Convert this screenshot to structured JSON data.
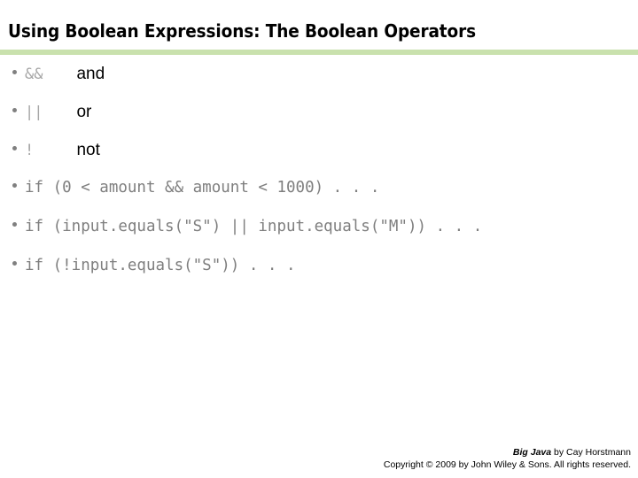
{
  "slide": {
    "title": "Using Boolean Expressions: The Boolean Operators",
    "accent_color": "#c9e1ad",
    "code_color": "#7f7f7f",
    "operator_symbol_color": "#a6a6a6",
    "bullet_color": "#808080"
  },
  "operators": [
    {
      "symbol": "&&",
      "word": "and"
    },
    {
      "symbol": "||",
      "word": "or"
    },
    {
      "symbol": "!",
      "word": "not"
    }
  ],
  "examples": [
    {
      "code": "if (0 < amount && amount < 1000) . . ."
    },
    {
      "code": "if (input.equals(\"S\") || input.equals(\"M\")) . . ."
    },
    {
      "code": "if (!input.equals(\"S\")) . . ."
    }
  ],
  "footer": {
    "book": "Big Java",
    "byline": " by Cay Horstmann",
    "copyright": "Copyright © 2009 by John Wiley & Sons.  All rights reserved."
  }
}
